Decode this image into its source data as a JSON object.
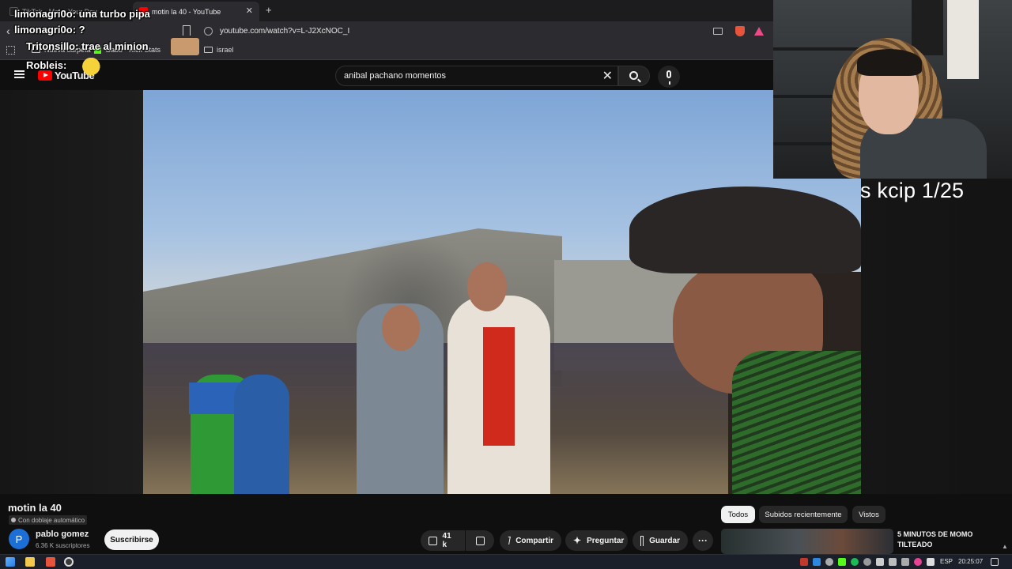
{
  "browser": {
    "tabs": [
      {
        "label": "TikTok - Make Your Day",
        "active": false
      },
      {
        "label": "motin la 40 - YouTube",
        "active": true
      }
    ],
    "url": "youtube.com/watch?v=L-J2XcNOC_I",
    "bookmarks": [
      {
        "label": "Nueva carpeta",
        "icon": "folder-icon"
      },
      {
        "label": "Gabo - Kick Stats",
        "icon": "kick-icon"
      },
      {
        "label": "israel",
        "icon": "folder-icon"
      }
    ]
  },
  "youtube": {
    "logo_text": "YouTube",
    "search_value": "anibal pachano momentos",
    "video": {
      "title": "motin la 40",
      "dubbing_badge": "Con doblaje automático",
      "overlay_text": "s kcip 1/25"
    },
    "channel": {
      "avatar_letter": "P",
      "name": "pablo gomez",
      "subscribers": "6.36 K suscriptores",
      "subscribe_label": "Suscribirse"
    },
    "actions": {
      "likes": "41 k",
      "share": "Compartir",
      "ask": "Preguntar",
      "save": "Guardar",
      "more": "···"
    },
    "filter_chips": [
      {
        "label": "Todos",
        "active": true
      },
      {
        "label": "Subidos recientemente",
        "active": false
      },
      {
        "label": "Vistos",
        "active": false
      }
    ],
    "recommendation": {
      "title": "5 MINUTOS DE MOMO TILTEADO"
    }
  },
  "chat": [
    {
      "user": "limonagri0o",
      "message": "una turbo pipa"
    },
    {
      "user": "limonagri0o",
      "message": "?"
    },
    {
      "user": "Tritonsillo",
      "message": "trae al minion"
    },
    {
      "user": "Robleis",
      "message": ""
    }
  ],
  "taskbar": {
    "language": "ESP",
    "time": "20:25:07"
  },
  "colors": {
    "youtube_red": "#ff0000",
    "background": "#0f0f0f",
    "pill_bg": "#272727",
    "kick_green": "#53fc18"
  }
}
